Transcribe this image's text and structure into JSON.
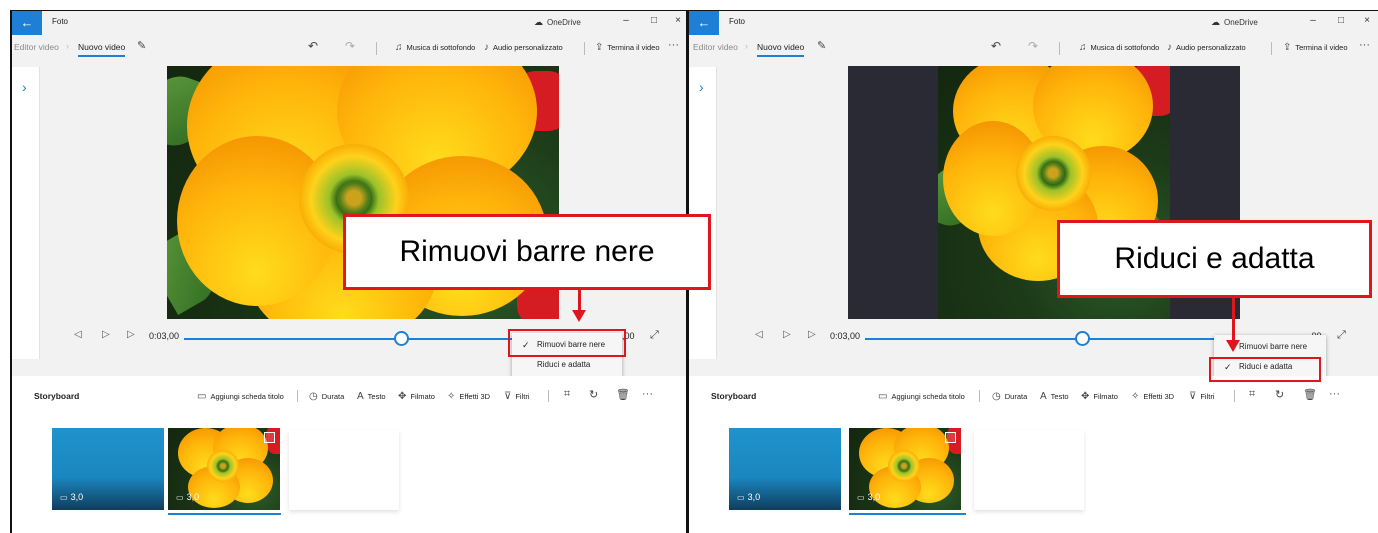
{
  "app": {
    "title": "Foto",
    "onedrive_label": "OneDrive",
    "back_icon": "←",
    "window_controls": [
      "–",
      "□",
      "×"
    ]
  },
  "toolbar": {
    "breadcrumb_parent": "Editor video",
    "breadcrumb_sep": "›",
    "breadcrumb_current": "Nuovo video",
    "edit_name_icon": "pencil-icon",
    "undo_icon": "undo-icon",
    "redo_icon": "redo-icon",
    "background_music": "Musica di sottofondo",
    "custom_audio": "Audio personalizzato",
    "finish_video": "Termina il video",
    "more": "···"
  },
  "player": {
    "current_time": "0:03,00",
    "end_time_left": ",00",
    "end_time_right": ",00",
    "progress": 0.62
  },
  "aspect_menu": {
    "items": [
      {
        "label": "Rimuovi barre nere"
      },
      {
        "label": "Riduci e adatta"
      }
    ],
    "selected_left": 0,
    "selected_right": 1,
    "check": "✓"
  },
  "storyboard": {
    "title": "Storyboard",
    "add_title_card": "Aggiungi scheda titolo",
    "duration": "Durata",
    "text": "Testo",
    "motion": "Filmato",
    "effects_3d": "Effetti 3D",
    "filters": "Filtri",
    "more": "···",
    "clips": [
      {
        "type": "title-card",
        "duration": "3,0",
        "color": "#1f93cc"
      },
      {
        "type": "photo",
        "duration": "3,0"
      }
    ]
  },
  "annotations": {
    "left_callout": "Rimuovi barre nere",
    "right_callout": "Riduci e adatta",
    "color": "#e0161e"
  },
  "colors": {
    "accent": "#1e7fd6",
    "letterbox": "#2a2a34"
  }
}
